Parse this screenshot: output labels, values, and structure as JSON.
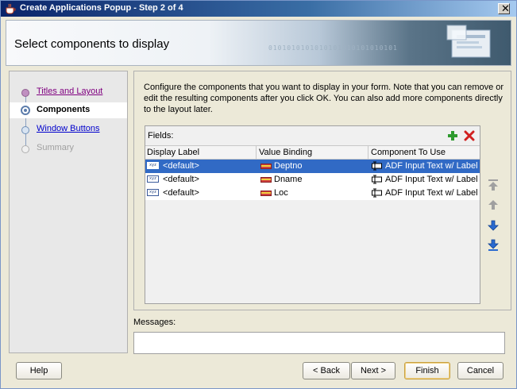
{
  "window": {
    "title": "Create Applications Popup - Step 2 of 4",
    "close_glyph": "✕"
  },
  "banner": {
    "heading": "Select components to display",
    "decor_digits": "0101010101010101010101010101"
  },
  "nav": {
    "items": [
      {
        "label": "Titles and Layout",
        "state": "visited"
      },
      {
        "label": "Components",
        "state": "active"
      },
      {
        "label": "Window Buttons",
        "state": "link"
      },
      {
        "label": "Summary",
        "state": "disabled"
      }
    ]
  },
  "main": {
    "instructions": "Configure the components that you want to display in your form.  Note that you can remove or edit the resulting components after you click OK.  You can also add more components directly to the layout later.",
    "fields_label": "Fields:",
    "columns": [
      "Display Label",
      "Value Binding",
      "Component To Use"
    ],
    "rows": [
      {
        "display_label": "<default>",
        "binding": "Deptno",
        "component": "ADF Input Text w/ Label",
        "selected": true
      },
      {
        "display_label": "<default>",
        "binding": "Dname",
        "component": "ADF Input Text w/ Label",
        "selected": false
      },
      {
        "display_label": "<default>",
        "binding": "Loc",
        "component": "ADF Input Text w/ Label",
        "selected": false
      }
    ],
    "xyz_icon_text": "xyz"
  },
  "messages": {
    "label": "Messages:",
    "value": ""
  },
  "buttons": {
    "help": "Help",
    "back": "< Back",
    "next": "Next >",
    "finish": "Finish",
    "cancel": "Cancel"
  },
  "colors": {
    "selection": "#316ac5",
    "add_icon": "#2e9a2e",
    "delete_icon": "#d02020",
    "arrow_active": "#2a6ad0",
    "arrow_disabled": "#a0a0a0"
  }
}
